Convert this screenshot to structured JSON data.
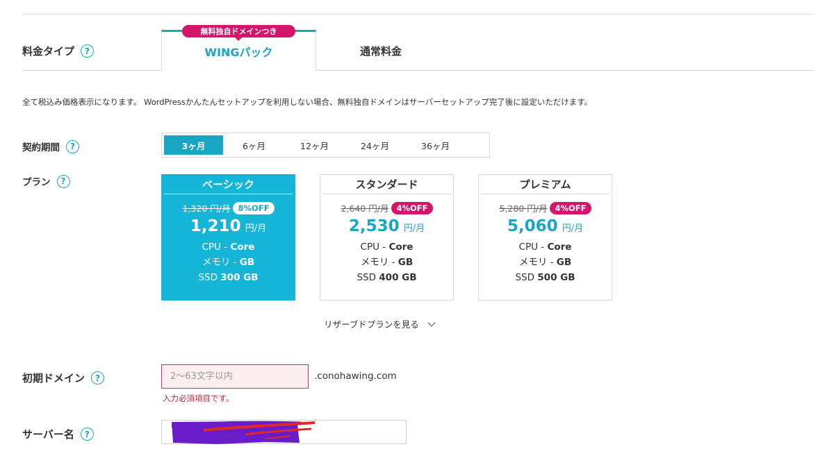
{
  "price_type": {
    "label": "料金タイプ",
    "tabs": [
      {
        "label": "WINGパック",
        "active": true,
        "badge": "無料独自ドメインつき"
      },
      {
        "label": "通常料金",
        "active": false
      }
    ]
  },
  "note": "全て税込み価格表示になります。 WordPressかんたんセットアップを利用しない場合、無料独自ドメインはサーバーセットアップ完了後に設定いただけます。",
  "contract_period": {
    "label": "契約期間",
    "options": [
      "3ヶ月",
      "6ヶ月",
      "12ヶ月",
      "24ヶ月",
      "36ヶ月"
    ],
    "selected": "3ヶ月"
  },
  "plan": {
    "label": "プラン",
    "cards": [
      {
        "name": "ベーシック",
        "old_price": "1,320 円/月",
        "discount": "8%OFF",
        "price": "1,210",
        "unit": "円/月",
        "cpu_label": "CPU -",
        "cpu_value": "Core",
        "mem_label": "メモリ -",
        "mem_value": "GB",
        "ssd_label": "SSD",
        "ssd_value": "300 GB",
        "selected": true
      },
      {
        "name": "スタンダード",
        "old_price": "2,640 円/月",
        "discount": "4%OFF",
        "price": "2,530",
        "unit": "円/月",
        "cpu_label": "CPU -",
        "cpu_value": "Core",
        "mem_label": "メモリ -",
        "mem_value": "GB",
        "ssd_label": "SSD",
        "ssd_value": "400 GB",
        "selected": false
      },
      {
        "name": "プレミアム",
        "old_price": "5,280 円/月",
        "discount": "4%OFF",
        "price": "5,060",
        "unit": "円/月",
        "cpu_label": "CPU -",
        "cpu_value": "Core",
        "mem_label": "メモリ -",
        "mem_value": "GB",
        "ssd_label": "SSD",
        "ssd_value": "500 GB",
        "selected": false
      }
    ],
    "reserved_link": "リザーブドプランを見る"
  },
  "initial_domain": {
    "label": "初期ドメイン",
    "value": "",
    "placeholder": "2〜63文字以内",
    "suffix": ".conohawing.com",
    "error": "入力必須項目です。"
  },
  "server_name": {
    "label": "サーバー名",
    "value": ""
  },
  "colors": {
    "accent": "#1ba5c4",
    "selected_card": "#15b5d8",
    "badge": "#d4156b",
    "error": "#cc2233"
  },
  "icons": {
    "help": "question-circle-icon",
    "expand": "chevron-down-icon"
  }
}
